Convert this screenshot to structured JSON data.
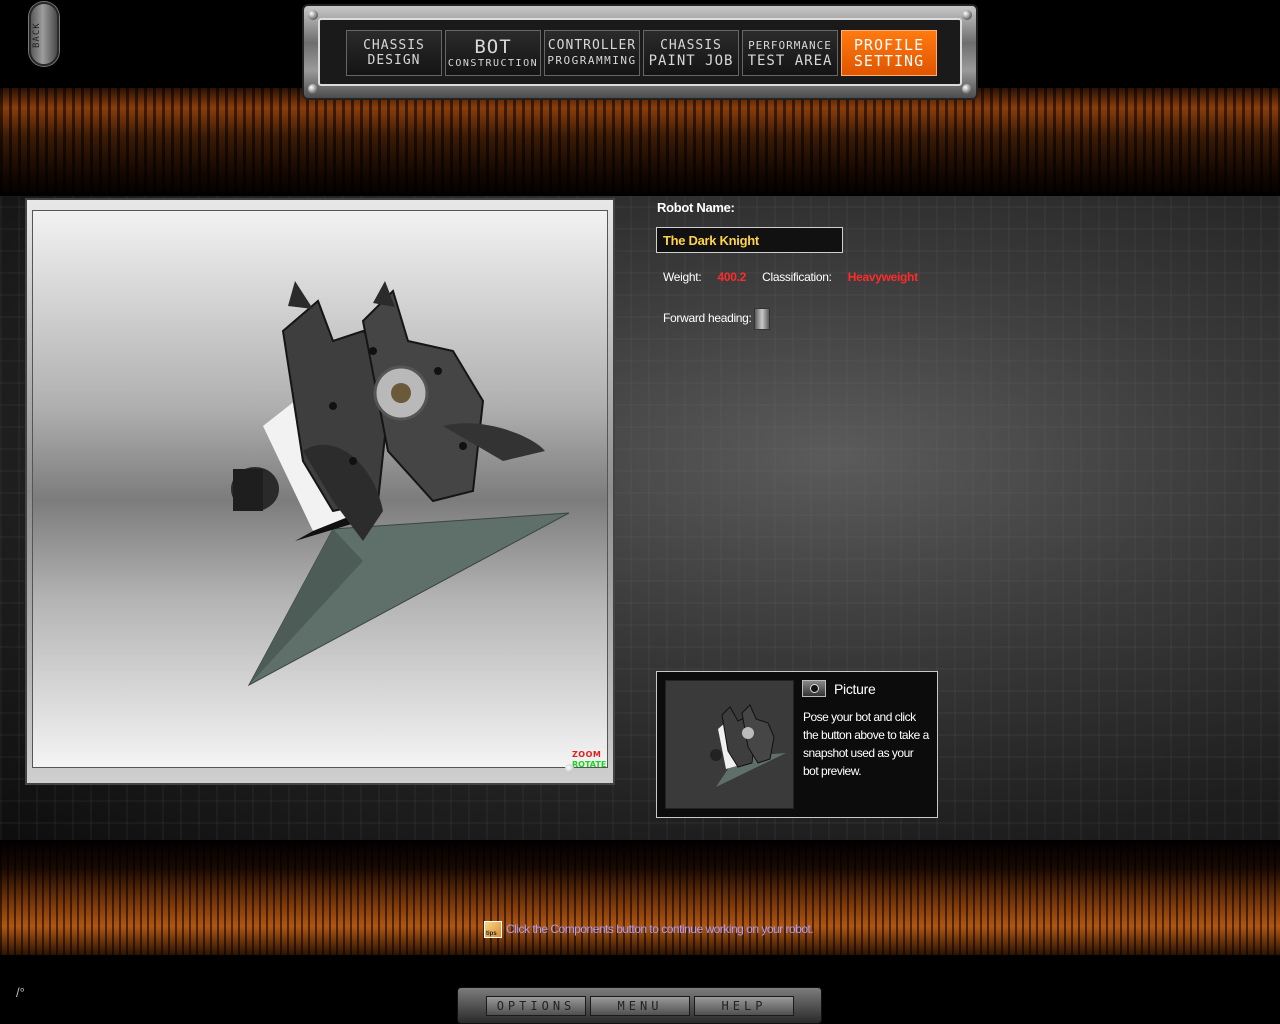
{
  "back_button": {
    "label": "BACK"
  },
  "nav": {
    "tabs": [
      {
        "line1": "Chassis",
        "line2": "Design",
        "active": false
      },
      {
        "line1": "Bot",
        "line2": "Construction",
        "active": false
      },
      {
        "line1": "Controller",
        "line2": "Programming",
        "active": false
      },
      {
        "line1": "Chassis",
        "line2": "Paint Job",
        "active": false
      },
      {
        "line1": "Performance",
        "line2": "Test Area",
        "active": false
      },
      {
        "line1": "Profile",
        "line2": "Setting",
        "active": true
      }
    ],
    "accent_color": "#ff6a00"
  },
  "viewport": {
    "zoom_label": "ZOOM",
    "rotate_label": "ROTATE"
  },
  "profile": {
    "robot_name_label": "Robot Name:",
    "robot_name_value": "The Dark Knight",
    "weight_label": "Weight:",
    "weight_value": "400.2",
    "classification_label": "Classification:",
    "classification_value": "Heavyweight",
    "forward_heading_label": "Forward heading:",
    "value_color": "#ff2b2b",
    "name_color": "#ffd24a"
  },
  "picture": {
    "title": "Picture",
    "description": "Pose your bot and click the button above to take a snapshot used as your bot preview.",
    "camera_icon": "camera-icon"
  },
  "hint": {
    "icon_text": "tips",
    "text": "Click the Components button to continue working on your robot."
  },
  "bottom_bar": {
    "options_label": "OPTIONS",
    "menu_label": "MENU",
    "help_label": "HELP"
  },
  "status": {
    "icon_text": "/°"
  }
}
